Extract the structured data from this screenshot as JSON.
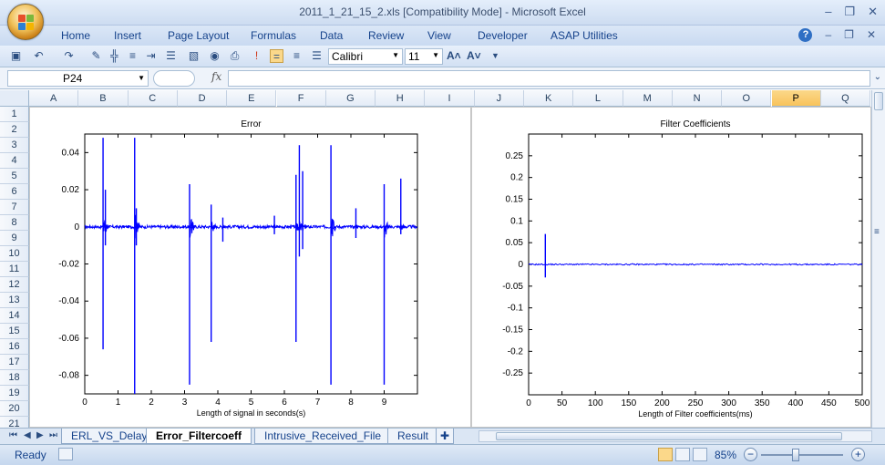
{
  "window": {
    "title": "2011_1_21_15_2.xls  [Compatibility Mode] - Microsoft Excel"
  },
  "ribbon": {
    "tabs": [
      "Home",
      "Insert",
      "Page Layout",
      "Formulas",
      "Data",
      "Review",
      "View",
      "Developer",
      "ASAP Utilities"
    ]
  },
  "toolbar": {
    "font_name": "Calibri",
    "font_size": "11"
  },
  "formula_bar": {
    "cell_ref": "P24",
    "fx_label": "fx",
    "formula": ""
  },
  "columns": [
    "A",
    "B",
    "C",
    "D",
    "E",
    "F",
    "G",
    "H",
    "I",
    "J",
    "K",
    "L",
    "M",
    "N",
    "O",
    "P",
    "Q"
  ],
  "selected_column": "P",
  "rows": [
    "1",
    "2",
    "3",
    "4",
    "5",
    "6",
    "7",
    "8",
    "9",
    "10",
    "11",
    "12",
    "13",
    "14",
    "15",
    "16",
    "17",
    "18",
    "19",
    "20",
    "21"
  ],
  "sheets": {
    "tabs": [
      "ERL_VS_Delay",
      "Error_Filtercoeff",
      "Intrusive_Received_File",
      "Result"
    ],
    "active": "Error_Filtercoeff"
  },
  "status": {
    "ready": "Ready",
    "zoom": "85%",
    "zoom_level": 0.42
  },
  "chart_data": [
    {
      "type": "line",
      "title": "Error",
      "xlabel": "Length of signal in seconds(s)",
      "ylabel": "",
      "xlim": [
        0,
        10
      ],
      "ylim": [
        -0.09,
        0.05
      ],
      "xticks": [
        0,
        1,
        2,
        3,
        4,
        5,
        6,
        7,
        8,
        9
      ],
      "yticks": [
        0.04,
        0.02,
        0,
        -0.02,
        -0.04,
        -0.06,
        -0.08
      ],
      "ytick_labels": [
        "0.04",
        "0.02",
        "0",
        "-0.02",
        "-0.04",
        "-0.06",
        "-0.08"
      ],
      "color": "#0000ff",
      "spikes": [
        {
          "x": 0.55,
          "top": 0.048,
          "bottom": -0.066
        },
        {
          "x": 0.62,
          "top": 0.02,
          "bottom": -0.01
        },
        {
          "x": 1.5,
          "top": 0.048,
          "bottom": -0.09
        },
        {
          "x": 1.55,
          "top": 0.01,
          "bottom": -0.01
        },
        {
          "x": 3.15,
          "top": 0.023,
          "bottom": -0.085
        },
        {
          "x": 3.8,
          "top": 0.012,
          "bottom": -0.062
        },
        {
          "x": 4.15,
          "top": 0.005,
          "bottom": -0.008
        },
        {
          "x": 5.7,
          "top": 0.006,
          "bottom": -0.004
        },
        {
          "x": 6.35,
          "top": 0.028,
          "bottom": -0.062
        },
        {
          "x": 6.45,
          "top": 0.044,
          "bottom": -0.016
        },
        {
          "x": 6.55,
          "top": 0.03,
          "bottom": -0.012
        },
        {
          "x": 7.4,
          "top": 0.044,
          "bottom": -0.085
        },
        {
          "x": 8.15,
          "top": 0.01,
          "bottom": -0.006
        },
        {
          "x": 9.0,
          "top": 0.023,
          "bottom": -0.085
        },
        {
          "x": 9.5,
          "top": 0.026,
          "bottom": -0.004
        }
      ]
    },
    {
      "type": "line",
      "title": "Filter Coefficients",
      "xlabel": "Length of Filter coefficients(ms)",
      "ylabel": "",
      "xlim": [
        0,
        500
      ],
      "ylim": [
        -0.3,
        0.3
      ],
      "xticks": [
        0,
        50,
        100,
        150,
        200,
        250,
        300,
        350,
        400,
        450,
        500
      ],
      "yticks": [
        0.25,
        0.2,
        0.15,
        0.1,
        0.05,
        0,
        -0.05,
        -0.1,
        -0.15,
        -0.2,
        -0.25
      ],
      "ytick_labels": [
        "0.25",
        "0.2",
        "0.15",
        "0.1",
        "0.05",
        "0",
        "-0.05",
        "-0.1",
        "-0.15",
        "-0.2",
        "-0.25"
      ],
      "color": "#0000ff",
      "spikes": [
        {
          "x": 25,
          "top": 0.07,
          "bottom": -0.03
        }
      ]
    }
  ]
}
